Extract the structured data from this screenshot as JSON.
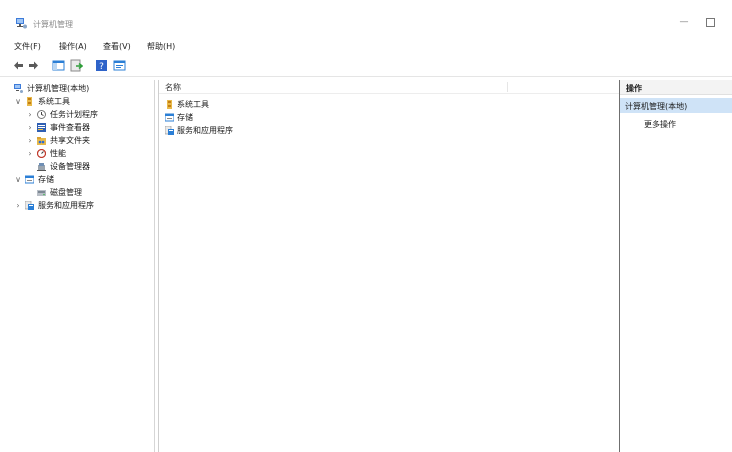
{
  "window": {
    "title": "计算机管理",
    "minimize_glyph": "—"
  },
  "menu": [
    "文件(F)",
    "操作(A)",
    "查看(V)",
    "帮助(H)"
  ],
  "toolbar": {
    "buttons": [
      "back-arrow-icon",
      "forward-arrow-icon",
      "show-hide-tree-icon",
      "export-list-icon",
      "help-icon",
      "properties-icon"
    ]
  },
  "tree": {
    "root": "计算机管理(本地)",
    "system_tools": "系统工具",
    "task_scheduler": "任务计划程序",
    "event_viewer": "事件查看器",
    "shared_folders": "共享文件夹",
    "performance": "性能",
    "device_manager": "设备管理器",
    "storage": "存储",
    "disk_management": "磁盘管理",
    "services_apps": "服务和应用程序",
    "expanded_glyph": "∨",
    "collapsed_glyph": "›"
  },
  "list": {
    "column_name": "名称",
    "items": [
      "系统工具",
      "存储",
      "服务和应用程序"
    ]
  },
  "actions": {
    "header": "操作",
    "section": "计算机管理(本地)",
    "more": "更多操作"
  },
  "colors": {
    "selection": "#cfe3f7",
    "folder_yellow": "#e8b94a",
    "accent_blue": "#2b6cd6"
  }
}
